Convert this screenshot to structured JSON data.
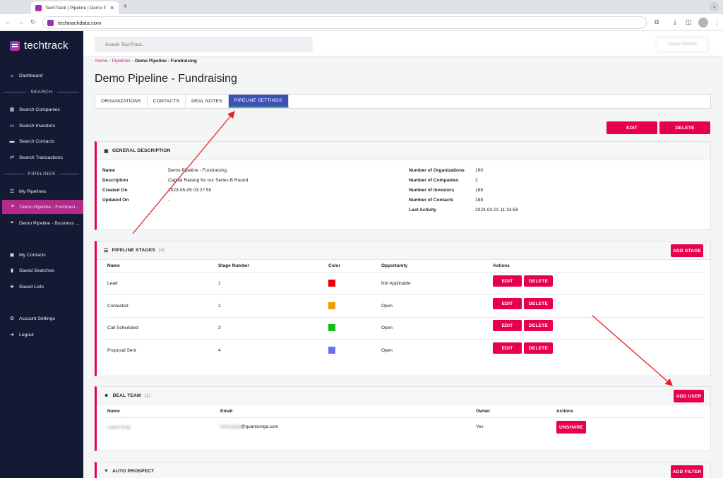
{
  "browser": {
    "tab_title": "TechTrack | Pipeline | Demo Pi...",
    "url": "techtrackdata.com"
  },
  "sidebar": {
    "logo": "techtrack",
    "dashboard": "Dashboard",
    "section_search": "SEARCH",
    "search_items": [
      "Search Companies",
      "Search Investors",
      "Search Contacts",
      "Search Transactions"
    ],
    "section_pipelines": "PIPELINES",
    "my_pipelines": "My Pipelines",
    "pipelines": [
      "Demo Pipeline - Fundraisi...",
      "Demo Pipeline - Business ..."
    ],
    "my_contacts": "My Contacts",
    "saved_searches": "Saved Searches",
    "saved_lists": "Saved Lists",
    "account_settings": "Account Settings",
    "logout": "Logout"
  },
  "topbar": {
    "search_placeholder": "Search TechTrack...",
    "user_name": "Shawn Nemeth"
  },
  "breadcrumb": {
    "home": "Home",
    "pipelines": "Pipelines",
    "current": "Demo Pipeline - Fundraising"
  },
  "page_title": "Demo Pipeline - Fundraising",
  "tabs": [
    "ORGANIZATIONS",
    "CONTACTS",
    "DEAL NOTES",
    "PIPELINE SETTINGS"
  ],
  "actions": {
    "edit": "EDIT",
    "delete": "DELETE"
  },
  "general": {
    "title": "GENERAL DESCRIPTION",
    "left": [
      {
        "label": "Name",
        "value": "Demo Pipeline - Fundraising"
      },
      {
        "label": "Description",
        "value": "Capital Raising for our Series B Round"
      },
      {
        "label": "Created On",
        "value": "2023-05-05 03:27:59"
      },
      {
        "label": "Updated On",
        "value": "-"
      }
    ],
    "right": [
      {
        "label": "Number of Organizations",
        "value": "190"
      },
      {
        "label": "Number of Companies",
        "value": "2"
      },
      {
        "label": "Number of Investors",
        "value": "188"
      },
      {
        "label": "Number of Contacts",
        "value": "188"
      },
      {
        "label": "Last Activity",
        "value": "2024-03-01 11:34:58"
      }
    ]
  },
  "stages": {
    "title": "PIPELINE STAGES",
    "count": "(4)",
    "add_label": "ADD STAGE",
    "columns": [
      "Name",
      "Stage Number",
      "Color",
      "Opportunity",
      "Actions"
    ],
    "rows": [
      {
        "name": "Lead",
        "number": "1",
        "color": "#ee0000",
        "opportunity": "Not Applicable"
      },
      {
        "name": "Contacted",
        "number": "2",
        "color": "#f5980a",
        "opportunity": "Open"
      },
      {
        "name": "Call Scheduled",
        "number": "3",
        "color": "#10c010",
        "opportunity": "Open"
      },
      {
        "name": "Proposal Sent",
        "number": "4",
        "color": "#6b6ff2",
        "opportunity": "Open"
      }
    ]
  },
  "deal_team": {
    "title": "DEAL TEAM",
    "count": "(1)",
    "add_label": "ADD USER",
    "columns": [
      "Name",
      "Email",
      "Owner",
      "Actions"
    ],
    "rows": [
      {
        "name": "Laura Gray",
        "email_user": "laura.gray",
        "email_domain": "@quantumga.com",
        "owner": "Yes",
        "action": "UNSHARE"
      }
    ]
  },
  "auto_prospect": {
    "title": "AUTO PROSPECT",
    "add_label": "ADD FILTER"
  },
  "colors": {
    "accent": "#e6004d",
    "sidebar": "#141a33",
    "active_tab": "#3f51b5",
    "annotation_arrow": "#e82020"
  }
}
